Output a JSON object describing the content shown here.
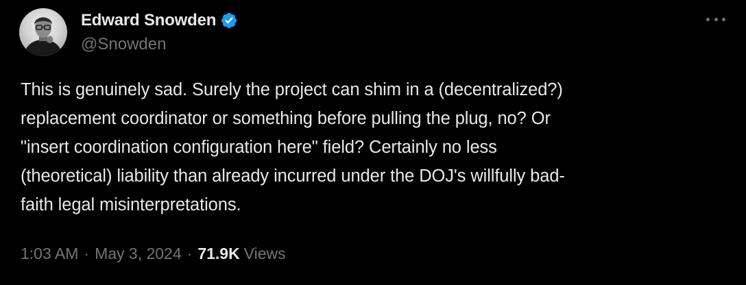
{
  "author": {
    "display_name": "Edward Snowden",
    "handle": "@Snowden",
    "verified": true,
    "verified_color": "#1d9bf0",
    "avatar_icon": "avatar-photo"
  },
  "more_icon": "more-horizontal-icon",
  "tweet": {
    "text": "This is genuinely sad. Surely the project can shim in a (decentralized?)\nreplacement coordinator or something before pulling the plug, no? Or\n\"insert coordination configuration here\" field? Certainly no less\n(theoretical) liability than already incurred under the DOJ's willfully bad-\nfaith legal misinterpretations."
  },
  "meta": {
    "time": "1:03 AM",
    "separator": "·",
    "date": "May 3, 2024",
    "views_count": "71.9K",
    "views_label": "Views"
  },
  "colors": {
    "background": "#000000",
    "primary_text": "#e7e9ea",
    "secondary_text": "#71767b"
  }
}
